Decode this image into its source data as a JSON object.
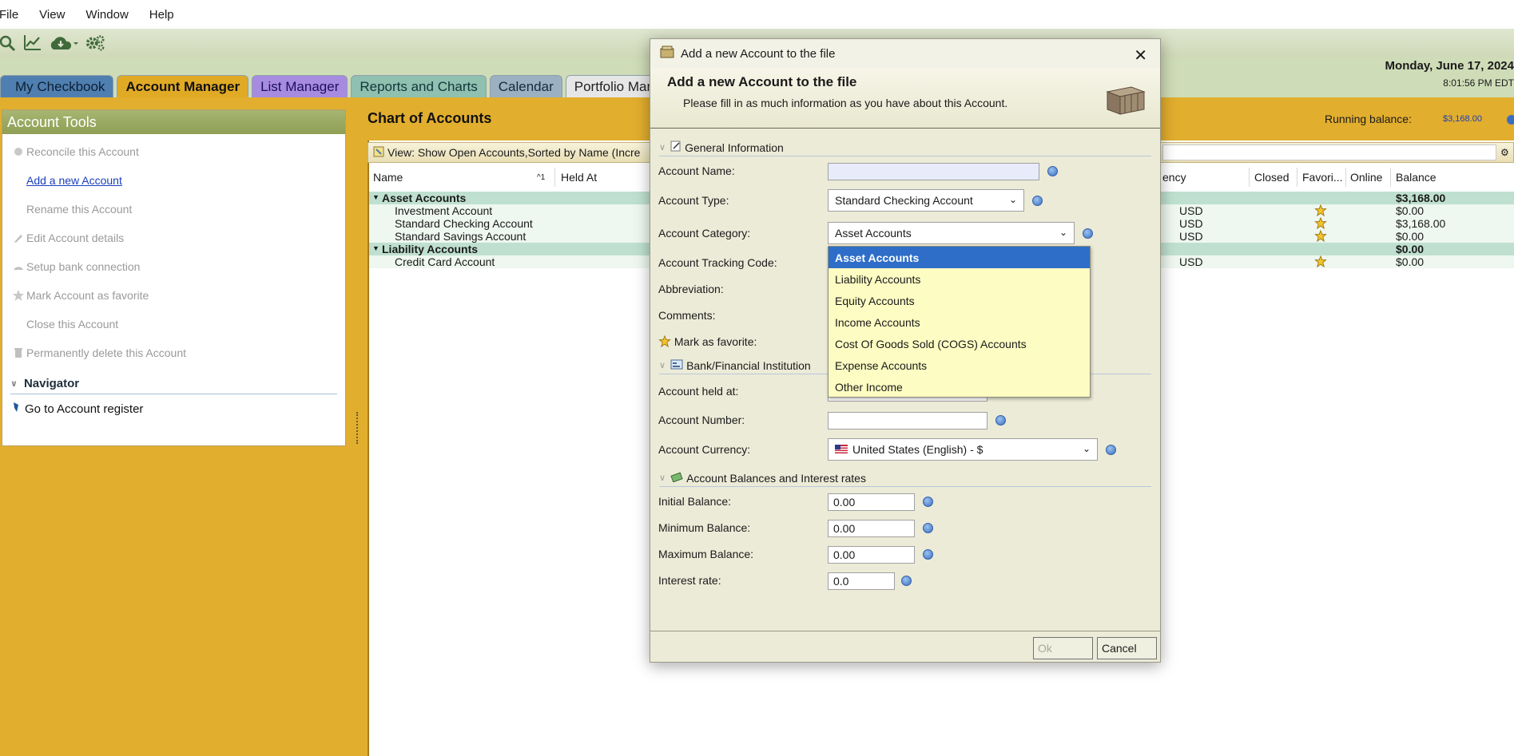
{
  "menu": [
    "File",
    "View",
    "Window",
    "Help"
  ],
  "toolbar": {
    "icons": [
      "search-icon",
      "chart-icon",
      "cloud-download-icon",
      "settings-icon"
    ]
  },
  "tabs": [
    "My Checkbook",
    "Account Manager",
    "List Manager",
    "Reports and Charts",
    "Calendar",
    "Portfolio Manag"
  ],
  "date": {
    "day": "Monday, June 17, 2024",
    "time": "8:01:56 PM EDT"
  },
  "tools": {
    "title": "Account Tools",
    "items": [
      "Reconcile this Account",
      "Add a new Account",
      "Rename this Account",
      "Edit Account details",
      "Setup bank connection",
      "Mark Account as favorite",
      "Close this Account",
      "Permanently delete this Account"
    ],
    "navigator": "Navigator",
    "nav_item": "Go to Account register"
  },
  "coa": {
    "title": "Chart of Accounts",
    "running_balance_label": "Running balance:",
    "running_balance_value": "$3,168.00",
    "view": "View: Show Open Accounts,Sorted by Name (Incre",
    "columns": {
      "name": "Name",
      "sort_indicator": "^1",
      "held_at": "Held At",
      "currency": "ency",
      "closed": "Closed",
      "favorite": "Favori...",
      "online": "Online",
      "balance": "Balance"
    },
    "rows": [
      {
        "name": "Asset Accounts",
        "currency": "",
        "fav": false,
        "balance": "$3,168.00",
        "group": true
      },
      {
        "name": "Investment Account",
        "currency": "USD",
        "fav": true,
        "balance": "$0.00",
        "group": false
      },
      {
        "name": "Standard Checking Account",
        "currency": "USD",
        "fav": true,
        "balance": "$3,168.00",
        "group": false
      },
      {
        "name": "Standard Savings Account",
        "currency": "USD",
        "fav": true,
        "balance": "$0.00",
        "group": false
      },
      {
        "name": "Liability Accounts",
        "currency": "",
        "fav": false,
        "balance": "$0.00",
        "group": true
      },
      {
        "name": "Credit Card Account",
        "currency": "USD",
        "fav": true,
        "balance": "$0.00",
        "group": false
      }
    ]
  },
  "dialog": {
    "window_title": "Add a new Account to the file",
    "heading": "Add a new Account to the file",
    "subheading": "Please fill in as much information as you have about this Account.",
    "sections": {
      "general": "General Information",
      "bank": "Bank/Financial Institution",
      "balances": "Account Balances and Interest rates"
    },
    "labels": {
      "account_name": "Account Name:",
      "account_type": "Account Type:",
      "account_category": "Account Category:",
      "tracking_code": "Account Tracking Code:",
      "abbreviation": "Abbreviation:",
      "comments": "Comments:",
      "favorite": "Mark as favorite:",
      "held_at": "Account held at:",
      "account_number": "Account Number:",
      "currency": "Account Currency:",
      "initial_balance": "Initial Balance:",
      "minimum_balance": "Minimum Balance:",
      "maximum_balance": "Maximum Balance:",
      "interest_rate": "Interest rate:"
    },
    "values": {
      "account_name": "",
      "account_type": "Standard Checking Account",
      "account_category": "Asset Accounts",
      "account_number": "",
      "currency": "United States (English) - $",
      "initial_balance": "0.00",
      "minimum_balance": "0.00",
      "maximum_balance": "0.00",
      "interest_rate": "0.0"
    },
    "category_options": [
      "Asset Accounts",
      "Liability Accounts",
      "Equity Accounts",
      "Income Accounts",
      "Cost Of Goods Sold (COGS) Accounts",
      "Expense Accounts",
      "Other Income"
    ],
    "buttons": {
      "ok": "Ok",
      "cancel": "Cancel"
    }
  }
}
